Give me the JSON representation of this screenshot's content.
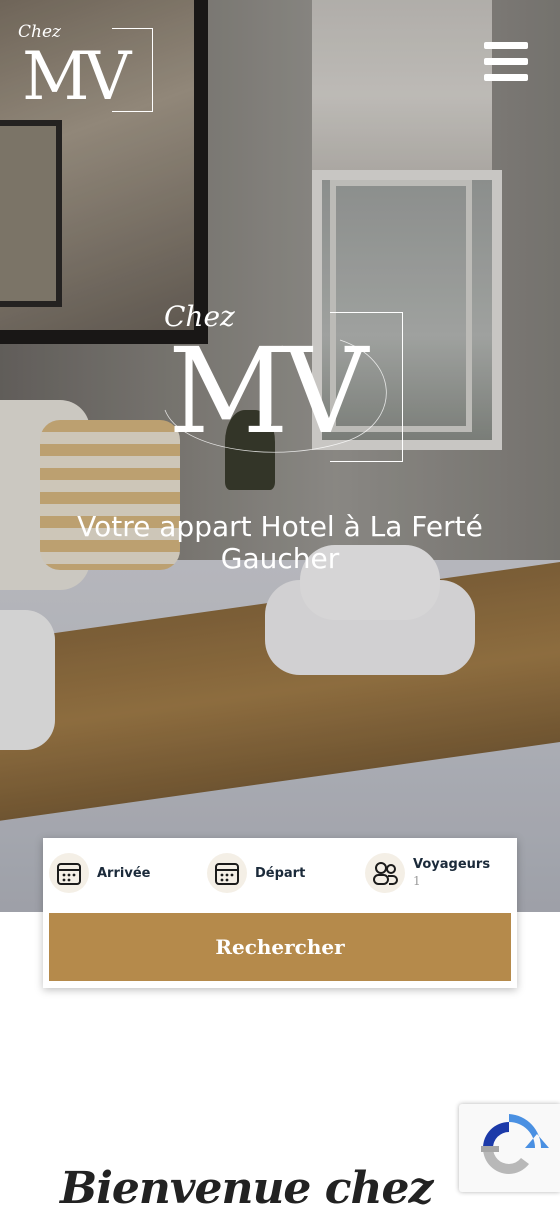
{
  "brand": {
    "chez": "Chez",
    "monogram": "MV",
    "color": "#ffffff"
  },
  "hero": {
    "title": "Votre appart Hotel à La Ferté Gaucher"
  },
  "search": {
    "arrival_label": "Arrivée",
    "departure_label": "Départ",
    "travelers_label": "Voyageurs",
    "travelers_value": "1",
    "button_label": "Rechercher",
    "accent_color": "#b58a4b"
  },
  "welcome": {
    "heading": "Bienvenue chez vous"
  },
  "icons": {
    "menu": "hamburger-menu-icon",
    "arrival": "calendar-icon",
    "departure": "calendar-icon",
    "travelers": "users-icon",
    "captcha": "recaptcha-icon"
  }
}
